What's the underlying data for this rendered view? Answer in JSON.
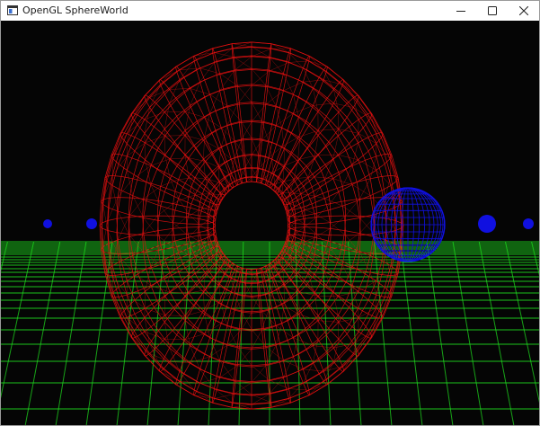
{
  "window": {
    "title": "OpenGL SphereWorld",
    "app_icon": "opengl-app-icon",
    "controls": {
      "minimize_icon": "minimize-icon",
      "maximize_icon": "maximize-icon",
      "close_icon": "close-icon"
    }
  },
  "scene": {
    "background_color": "#050505",
    "floor_grid_color": "#1fe51f",
    "torus_color": "#e01010",
    "sphere_color": "#1010e0",
    "objects": [
      "floor-grid",
      "wireframe-torus",
      "wireframe-sphere",
      "background-spheres"
    ]
  }
}
